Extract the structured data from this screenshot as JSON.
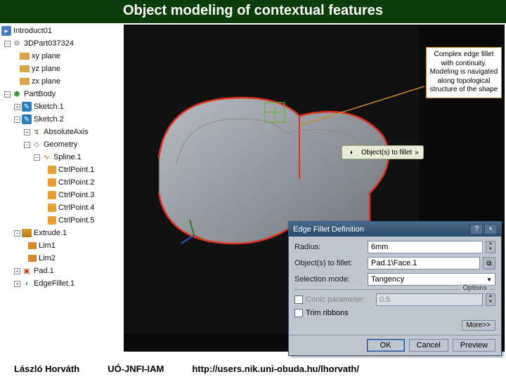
{
  "title": "Object modeling of contextual features",
  "tree": {
    "root": "Introduct01",
    "part": "3DPart037324",
    "planes": [
      "xy plane",
      "yz plane",
      "zx plane"
    ],
    "body": "PartBody",
    "sketch1": "Sketch.1",
    "sketch2": "Sketch.2",
    "axis": "AbsoluteAxis",
    "geometry": "Geometry",
    "spline": "Spline.1",
    "points": [
      "CtrlPoint.1",
      "CtrlPoint.2",
      "CtrlPoint.3",
      "CtrlPoint.4",
      "CtrlPoint.5"
    ],
    "extrude": "Extrude.1",
    "limits": [
      "Lim1",
      "Lim2"
    ],
    "pad": "Pad.1",
    "fillet": "EdgeFillet.1"
  },
  "tooltip": {
    "label": "Object(s) to fillet",
    "arrow": "»"
  },
  "annotation": "Complex edge fillet with continuity. Modeling is navigated along topological structure of the shape",
  "dialog": {
    "title": "Edge Fillet Definition",
    "radius_lbl": "Radius:",
    "radius_val": "6mm",
    "obj_lbl": "Object(s) to fillet:",
    "obj_val": "Pad.1\\Face.1",
    "sel_lbl": "Selection mode:",
    "sel_val": "Tangency",
    "options": "Options",
    "conic_lbl": "Conic parameter:",
    "conic_val": "0.5",
    "trim_lbl": "Trim ribbons",
    "more": "More>>",
    "ok": "OK",
    "cancel": "Cancel",
    "preview": "Preview"
  },
  "footer": {
    "author": "László Horváth",
    "org": "UÓ-JNFI-IAM",
    "url": "http://users.nik.uni-obuda.hu/lhorvath/"
  }
}
